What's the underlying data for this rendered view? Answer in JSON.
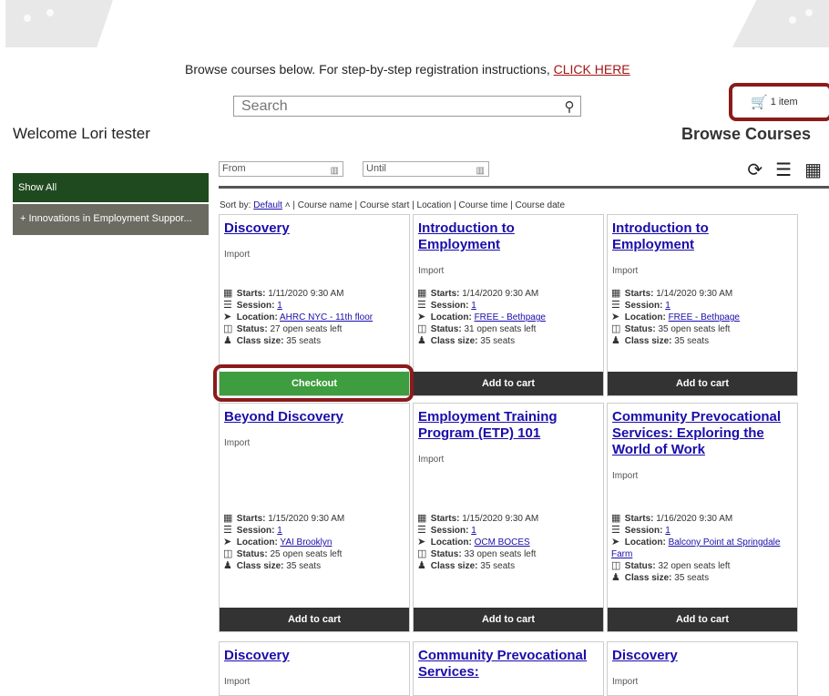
{
  "header": {
    "instruction_text": "Browse courses below. For step-by-step registration instructions, ",
    "instruction_link": "CLICK HERE",
    "search_placeholder": "Search",
    "cart_label": "1 item",
    "welcome": "Welcome Lori tester",
    "page_title": "Browse Courses"
  },
  "sidebar": {
    "show_all": "Show All",
    "items": [
      {
        "label": "+   Innovations in Employment Suppor..."
      }
    ]
  },
  "filter": {
    "from_placeholder": "From",
    "until_placeholder": "Until"
  },
  "sort": {
    "label": "Sort by:",
    "default": "Default",
    "arrow": "˄",
    "options": "| Course name | Course start | Location | Course time | Course date"
  },
  "labels": {
    "starts": "Starts:",
    "session": "Session:",
    "location": "Location:",
    "status": "Status:",
    "class_size": "Class size:"
  },
  "courses": [
    {
      "title": "Discovery",
      "category": "Import",
      "starts": "1/11/2020 9:30 AM",
      "session": "1",
      "location": "AHRC NYC - 11th floor",
      "status": "27 open seats left",
      "class_size": "35 seats",
      "button": "Checkout"
    },
    {
      "title": "Introduction to Employment",
      "category": "Import",
      "starts": "1/14/2020 9:30 AM",
      "session": "1",
      "location": "FREE - Bethpage",
      "status": "31 open seats left",
      "class_size": "35 seats",
      "button": "Add to cart"
    },
    {
      "title": "Introduction to Employment",
      "category": "Import",
      "starts": "1/14/2020 9:30 AM",
      "session": "1",
      "location": "FREE - Bethpage",
      "status": "35 open seats left",
      "class_size": "35 seats",
      "button": "Add to cart"
    },
    {
      "title": "Beyond Discovery",
      "category": "Import",
      "starts": "1/15/2020 9:30 AM",
      "session": "1",
      "location": "YAI Brooklyn",
      "status": "25 open seats left",
      "class_size": "35 seats",
      "button": "Add to cart"
    },
    {
      "title": "Employment Training Program (ETP) 101",
      "category": "Import",
      "starts": "1/15/2020 9:30 AM",
      "session": "1",
      "location": "OCM BOCES",
      "status": "33 open seats left",
      "class_size": "35 seats",
      "button": "Add to cart"
    },
    {
      "title": "Community Prevocational Services: Exploring the World of Work",
      "category": "Import",
      "starts": "1/16/2020 9:30 AM",
      "session": "1",
      "location": "Balcony Point at Springdale Farm",
      "status": "32 open seats left",
      "class_size": "35 seats",
      "button": "Add to cart"
    },
    {
      "title": "Discovery",
      "category": "Import"
    },
    {
      "title": "Community Prevocational Services:",
      "category": "Import"
    },
    {
      "title": "Discovery",
      "category": "Import"
    }
  ],
  "colors": {
    "highlight": "#8b1b1b",
    "checkout": "#3e9d3e",
    "sidebar_active": "#1f4a1f",
    "sidebar_item": "#6c6b62",
    "button_dark": "#333333",
    "link": "#1a0dab"
  }
}
